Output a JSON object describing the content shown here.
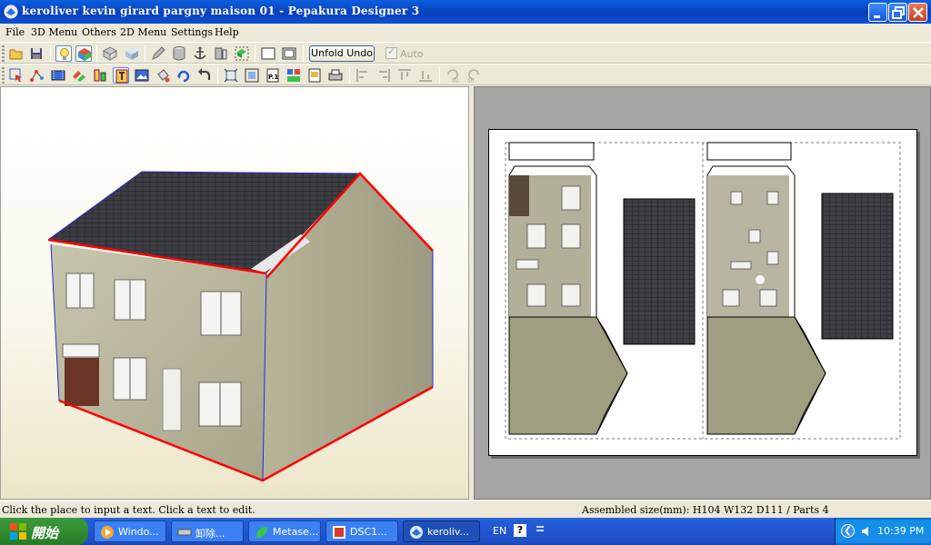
{
  "window": {
    "title": "keroliver kevin girard pargny maison 01 - Pepakura Designer 3"
  },
  "menu": {
    "items": [
      {
        "label": "File"
      },
      {
        "label": "3D Menu"
      },
      {
        "label": "Others"
      },
      {
        "label": "2D Menu"
      },
      {
        "label": "Settings"
      },
      {
        "label": "Help"
      }
    ]
  },
  "toolbar": {
    "unfold_undo_label": "Unfold Undo",
    "auto_label": "Auto",
    "auto_checked": true
  },
  "status": {
    "hint": "Click the place to input a text. Click a text to edit.",
    "assembled_size": "Assembled size(mm): H104 W132 D111 / Parts 4"
  },
  "taskbar": {
    "start_label": "開始",
    "tasks": [
      {
        "label": "Windo...",
        "icon": "media-player-icon"
      },
      {
        "label": "卸除...",
        "icon": "drive-icon"
      },
      {
        "label": "Metase...",
        "icon": "leaf-icon"
      },
      {
        "label": "DSC1...",
        "icon": "image-icon"
      },
      {
        "label": "keroliv...",
        "icon": "pepakura-icon"
      }
    ],
    "language": "EN",
    "clock": "10:39 PM"
  },
  "colors": {
    "titlebar": "#0a4ed0",
    "edge_red": "#ff0000",
    "edge_blue": "#2b2bd6",
    "wall": "#b8b49a",
    "roof": "#3a3b40"
  }
}
